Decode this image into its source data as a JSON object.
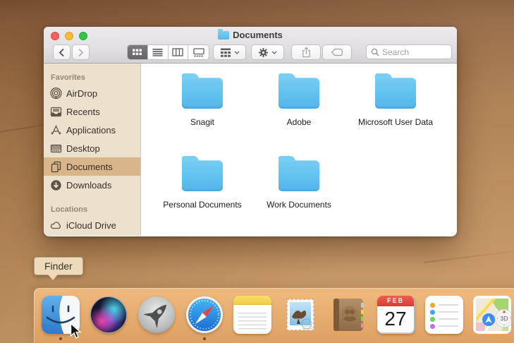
{
  "window": {
    "title": "Documents",
    "traffic_lights": [
      "close",
      "minimize",
      "zoom"
    ],
    "toolbar": {
      "back_icon": "chevron-left-icon",
      "forward_icon": "chevron-right-icon",
      "view_modes": [
        "icon-view",
        "list-view",
        "column-view",
        "gallery-view"
      ],
      "selected_view": "icon-view",
      "group_icon": "group-by-icon",
      "action_icon": "gear-icon",
      "share_icon": "share-icon",
      "tag_icon": "tag-icon",
      "search_placeholder": "Search"
    },
    "sidebar": {
      "favorites_header": "Favorites",
      "locations_header": "Locations",
      "favorites": [
        {
          "label": "AirDrop",
          "icon": "airdrop-icon",
          "selected": false
        },
        {
          "label": "Recents",
          "icon": "recents-icon",
          "selected": false
        },
        {
          "label": "Applications",
          "icon": "applications-icon",
          "selected": false
        },
        {
          "label": "Desktop",
          "icon": "desktop-icon",
          "selected": false
        },
        {
          "label": "Documents",
          "icon": "documents-icon",
          "selected": true
        },
        {
          "label": "Downloads",
          "icon": "downloads-icon",
          "selected": false
        }
      ],
      "locations": [
        {
          "label": "iCloud Drive",
          "icon": "icloud-icon",
          "selected": false
        }
      ]
    },
    "folders": [
      {
        "name": "Snagit",
        "icon": "blue-folder-icon"
      },
      {
        "name": "Adobe",
        "icon": "blue-folder-icon"
      },
      {
        "name": "Microsoft User Data",
        "icon": "blue-folder-icon"
      },
      {
        "name": "Personal Documents",
        "icon": "blue-folder-icon"
      },
      {
        "name": "Work Documents",
        "icon": "blue-folder-icon"
      }
    ]
  },
  "tooltip": {
    "label": "Finder"
  },
  "dock": {
    "apps": [
      {
        "name": "Finder",
        "icon": "finder-icon",
        "running": true
      },
      {
        "name": "Siri",
        "icon": "siri-icon",
        "running": false
      },
      {
        "name": "Launchpad",
        "icon": "launchpad-icon",
        "running": false
      },
      {
        "name": "Safari",
        "icon": "safari-icon",
        "running": true
      },
      {
        "name": "Notes",
        "icon": "notes-icon",
        "running": false
      },
      {
        "name": "Mail",
        "icon": "mail-icon",
        "running": false
      },
      {
        "name": "Contacts",
        "icon": "contacts-icon",
        "running": false
      },
      {
        "name": "Calendar",
        "icon": "calendar-icon",
        "running": false,
        "month": "FEB",
        "day": "27"
      },
      {
        "name": "Reminders",
        "icon": "reminders-icon",
        "running": false
      },
      {
        "name": "Maps",
        "icon": "maps-icon",
        "running": false,
        "badge": "3D"
      }
    ]
  },
  "colors": {
    "folder_blue": "#5FBEEC",
    "sidebar_selection": "#D9B58C",
    "dock_background": "#E3A76F",
    "wallpaper_brown": "#B28255",
    "traffic_red": "#F6605A",
    "traffic_yellow": "#F8BD38",
    "traffic_green": "#33C748"
  }
}
